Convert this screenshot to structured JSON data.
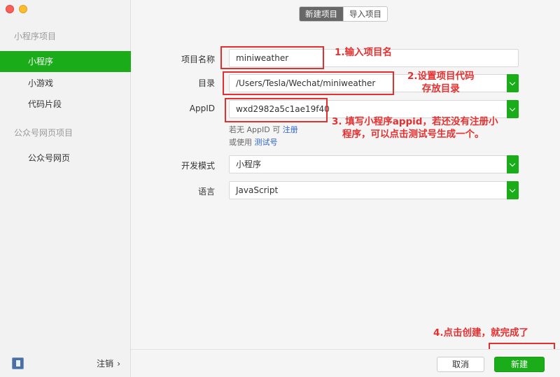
{
  "sidebar": {
    "section1_title": "小程序项目",
    "items": [
      {
        "label": "小程序",
        "active": true
      },
      {
        "label": "小游戏",
        "active": false
      },
      {
        "label": "代码片段",
        "active": false
      }
    ],
    "section2_title": "公众号网页项目",
    "items2": [
      {
        "label": "公众号网页"
      }
    ],
    "logout_label": "注销",
    "logout_arrow": "›"
  },
  "tabs": {
    "new_project": "新建项目",
    "import_project": "导入项目"
  },
  "form": {
    "project_name_label": "项目名称",
    "project_name_value": "miniweather",
    "directory_label": "目录",
    "directory_value": "/Users/Tesla/Wechat/miniweather",
    "appid_label": "AppID",
    "appid_value": "wxd2982a5c1ae19f40",
    "hint_no_appid_prefix": "若无 AppID 可",
    "hint_register_link": "注册",
    "hint_or_use_prefix": "或使用",
    "hint_test_link": "测试号",
    "dev_mode_label": "开发模式",
    "dev_mode_value": "小程序",
    "language_label": "语言",
    "language_value": "JavaScript"
  },
  "annotations": {
    "note1": "1.输入项目名",
    "note2_line1": "2.设置项目代码",
    "note2_line2": "存放目录",
    "note3_line1": "3. 填写小程序appid，若还没有注册小",
    "note3_line2": "程序，可以点击测试号生成一个。",
    "note4": "4.点击创建，就完成了",
    "color": "#e53030"
  },
  "footer": {
    "cancel_label": "取消",
    "create_label": "新建"
  },
  "colors": {
    "accent": "#1aad19"
  }
}
